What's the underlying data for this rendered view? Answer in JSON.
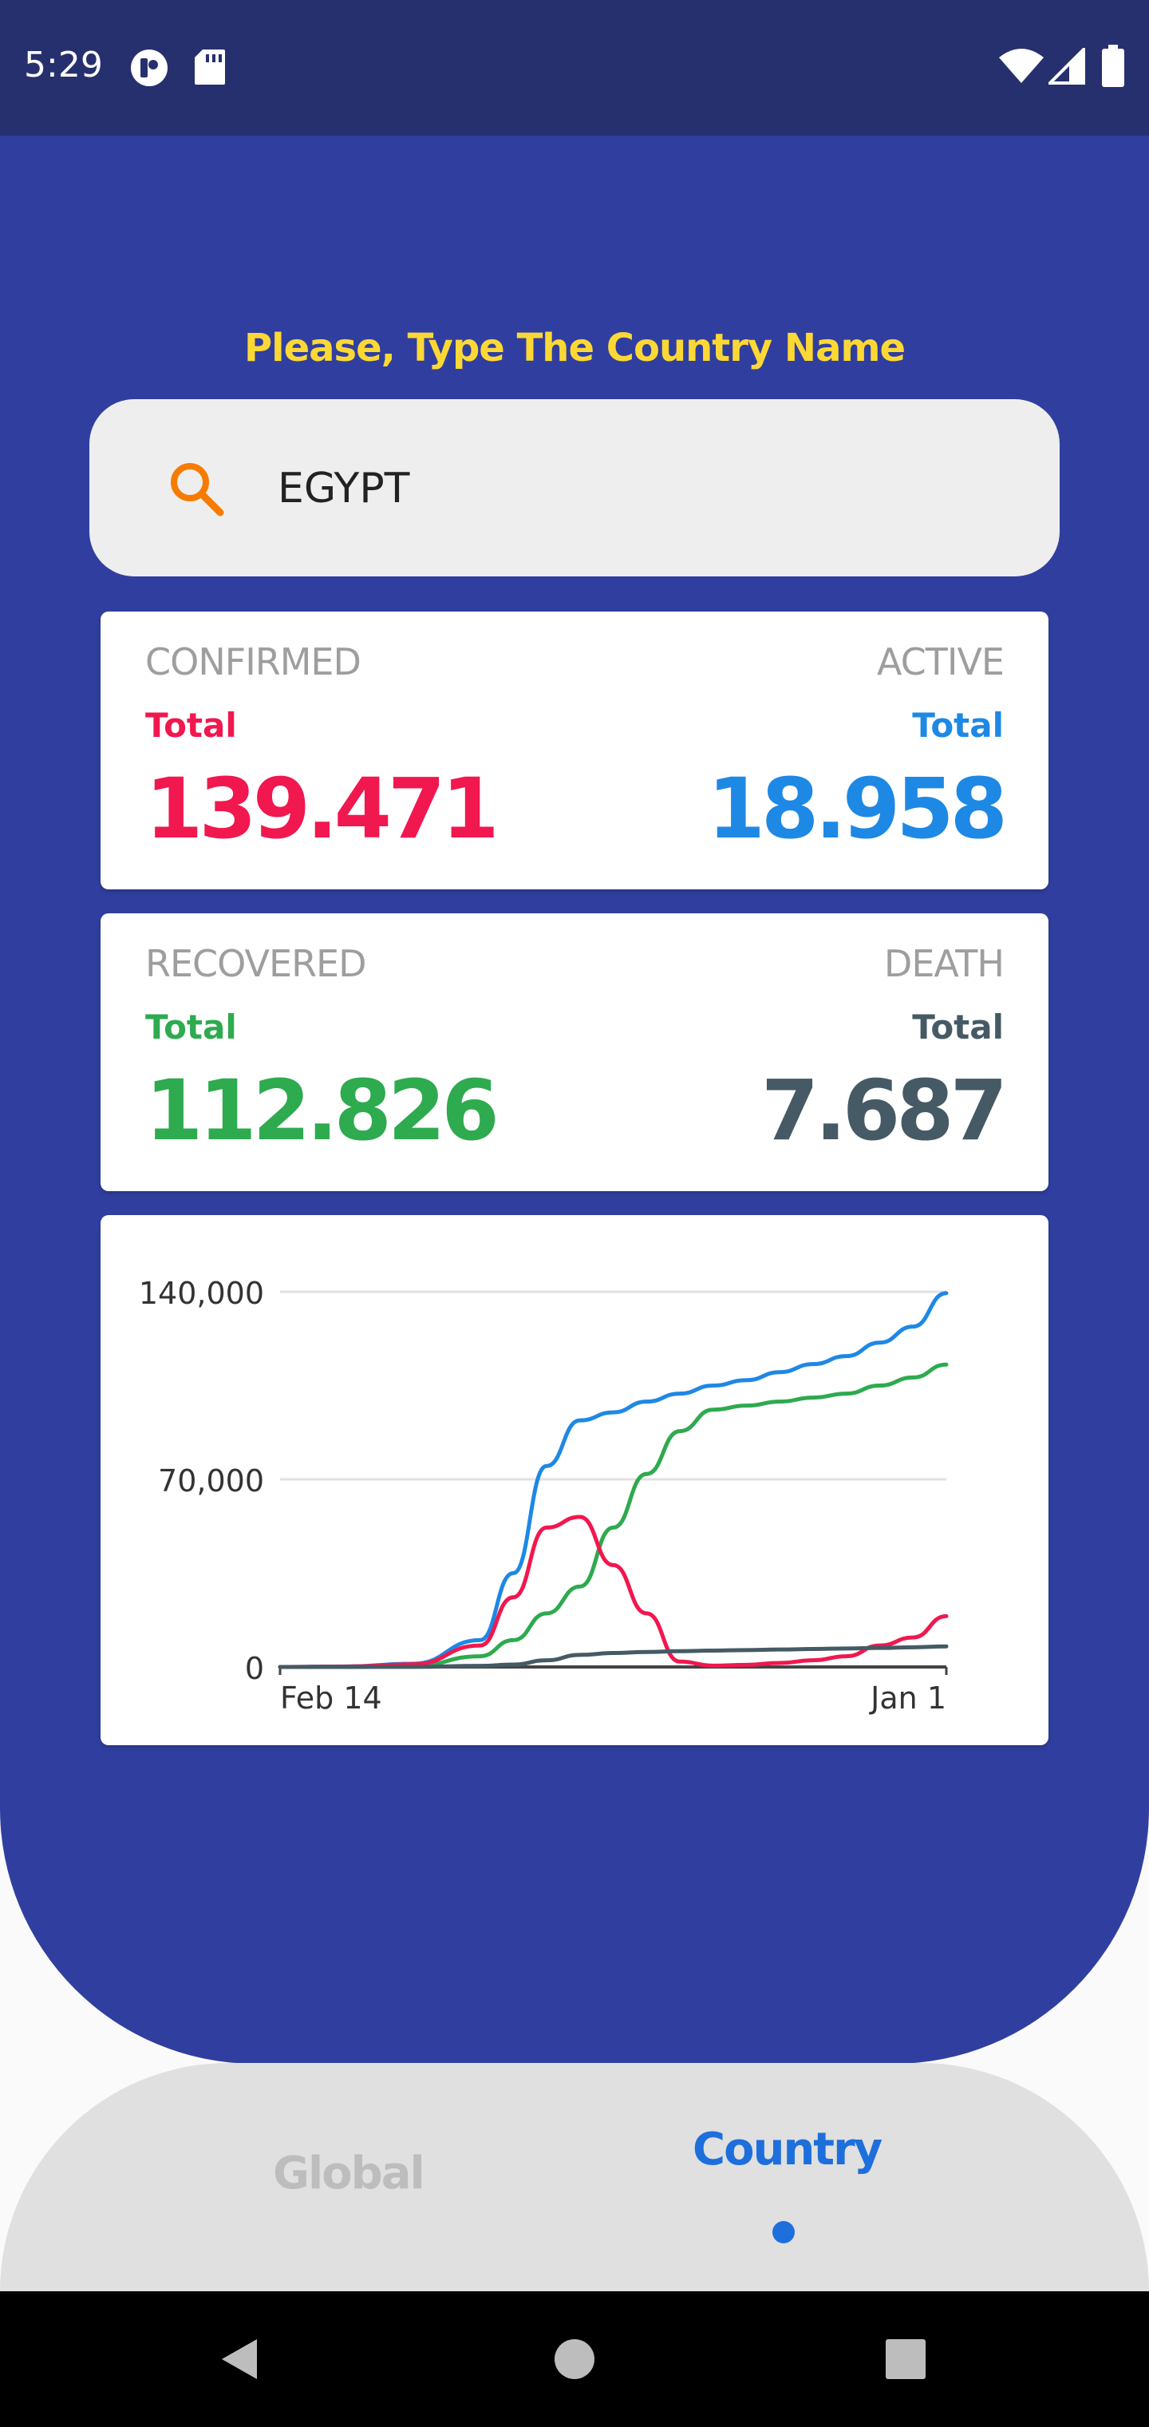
{
  "status_bar": {
    "time": "5:29",
    "icons": [
      "app-notification-icon",
      "sd-card-icon",
      "wifi-icon",
      "cell-signal-icon",
      "battery-icon"
    ]
  },
  "search": {
    "prompt": "Please, Type The Country Name",
    "value": "EGYPT"
  },
  "stats": {
    "confirmed": {
      "label": "CONFIRMED",
      "sub": "Total",
      "value": "139.471"
    },
    "active": {
      "label": "ACTIVE",
      "sub": "Total",
      "value": "18.958"
    },
    "recovered": {
      "label": "RECOVERED",
      "sub": "Total",
      "value": "112.826"
    },
    "death": {
      "label": "DEATH",
      "sub": "Total",
      "value": "7.687"
    }
  },
  "colors": {
    "accent_blue": "#303f9f",
    "confirmed": "#f0184f",
    "active": "#1e88e5",
    "recovered": "#2eaa4f",
    "death": "#455a64",
    "prompt": "#fdd835"
  },
  "chart_data": {
    "type": "line",
    "x_labels": [
      "Feb 14",
      "Jan 1"
    ],
    "x_range": [
      "Feb 14",
      "Jan 1"
    ],
    "y_ticks": [
      "0",
      "70,000",
      "140,000"
    ],
    "ylim": [
      0,
      140000
    ],
    "grid": true,
    "x": [
      0,
      0.1,
      0.2,
      0.3,
      0.35,
      0.4,
      0.45,
      0.5,
      0.55,
      0.6,
      0.65,
      0.7,
      0.75,
      0.8,
      0.85,
      0.9,
      0.95,
      1.0
    ],
    "series": [
      {
        "color": "#1e88e5",
        "values": [
          0,
          200,
          1200,
          10000,
          35000,
          75000,
          92000,
          95000,
          99000,
          102000,
          105000,
          107000,
          110000,
          113000,
          116000,
          121000,
          127000,
          139471
        ]
      },
      {
        "color": "#2eaa4f",
        "values": [
          0,
          50,
          300,
          4000,
          10000,
          20000,
          30000,
          52000,
          72000,
          88000,
          96000,
          97500,
          99000,
          100500,
          102000,
          105000,
          108000,
          112826
        ]
      },
      {
        "color": "#f0184f",
        "values": [
          0,
          150,
          1000,
          8000,
          26000,
          52000,
          56000,
          38000,
          20000,
          2000,
          500,
          800,
          1500,
          2500,
          4000,
          8000,
          11000,
          18958
        ]
      },
      {
        "color": "#455a64",
        "values": [
          0,
          5,
          50,
          400,
          900,
          2500,
          4500,
          5200,
          5600,
          5900,
          6100,
          6300,
          6500,
          6700,
          6900,
          7100,
          7350,
          7687
        ]
      }
    ]
  },
  "bottom_nav": {
    "global": "Global",
    "country": "Country"
  },
  "system_nav": {
    "icons": [
      "back-icon",
      "home-icon",
      "recents-icon"
    ]
  }
}
